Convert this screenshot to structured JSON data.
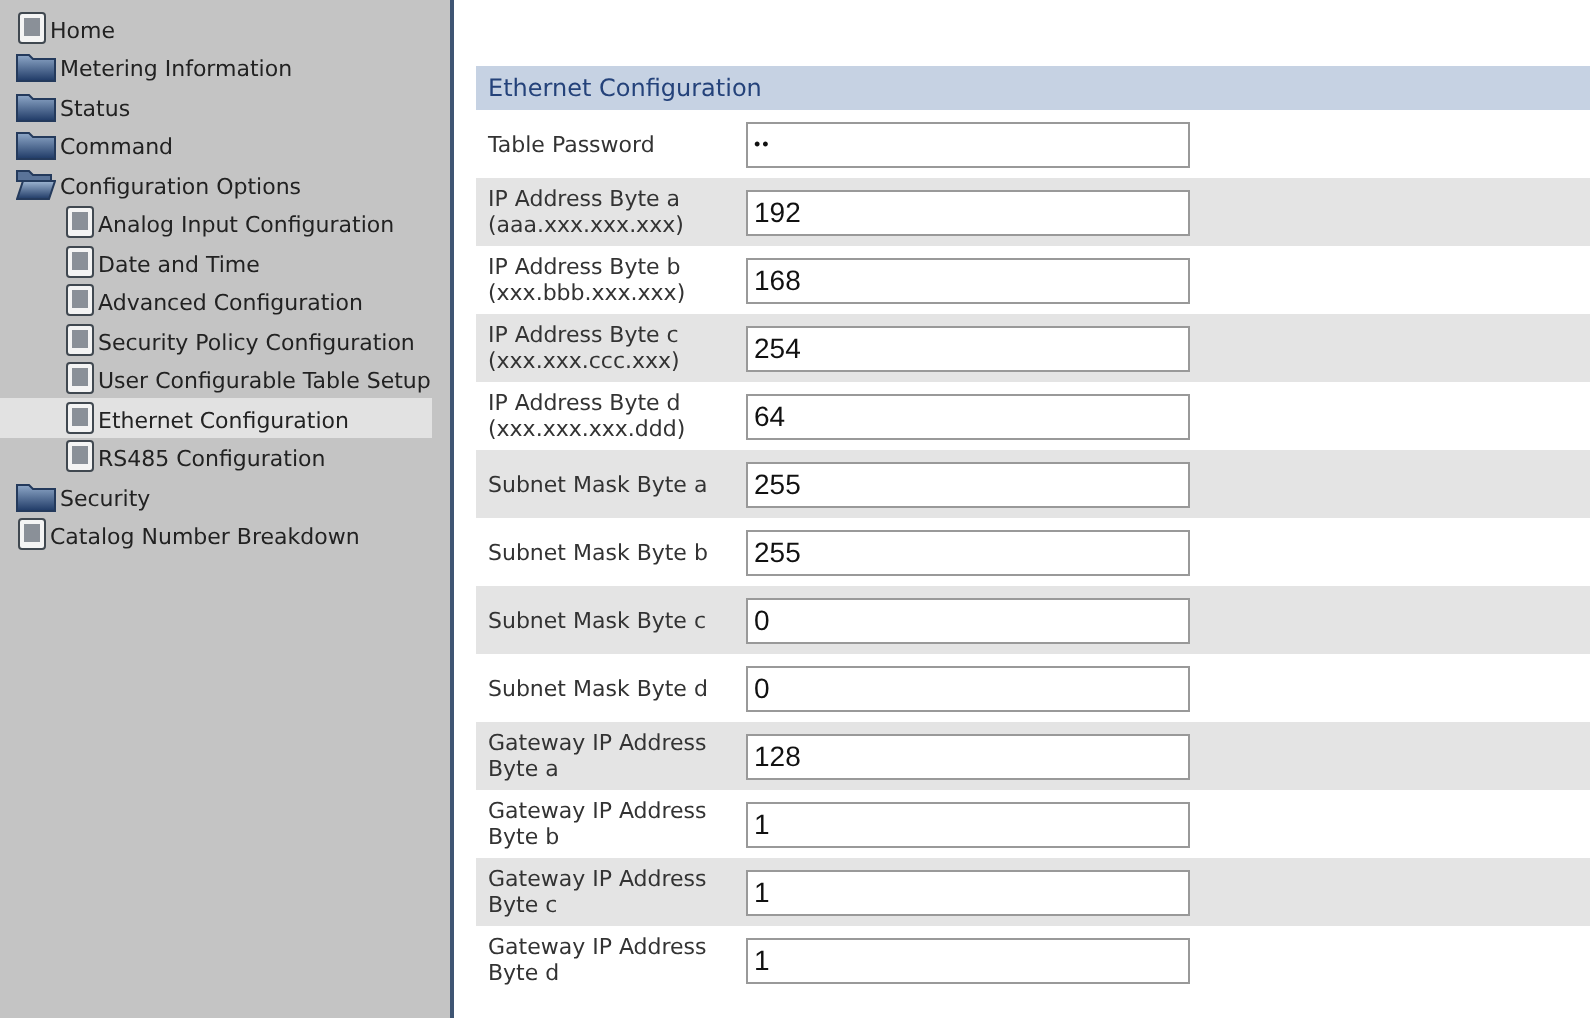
{
  "sidebar": {
    "items": [
      {
        "label": "Home",
        "kind": "page",
        "selected": false
      },
      {
        "label": "Metering Information",
        "kind": "folder",
        "expanded": false,
        "selected": false
      },
      {
        "label": "Status",
        "kind": "folder",
        "expanded": false,
        "selected": false
      },
      {
        "label": "Command",
        "kind": "folder",
        "expanded": false,
        "selected": false
      },
      {
        "label": "Configuration Options",
        "kind": "folder",
        "expanded": true,
        "selected": false,
        "children": [
          {
            "label": "Analog Input Configuration",
            "kind": "page",
            "selected": false
          },
          {
            "label": "Date and Time",
            "kind": "page",
            "selected": false
          },
          {
            "label": "Advanced Configuration",
            "kind": "page",
            "selected": false
          },
          {
            "label": "Security Policy Configuration",
            "kind": "page",
            "selected": false
          },
          {
            "label": "User Configurable Table Setup",
            "kind": "page",
            "selected": false
          },
          {
            "label": "Ethernet Configuration",
            "kind": "page",
            "selected": true
          },
          {
            "label": "RS485 Configuration",
            "kind": "page",
            "selected": false
          }
        ]
      },
      {
        "label": "Security",
        "kind": "folder",
        "expanded": false,
        "selected": false
      },
      {
        "label": "Catalog Number Breakdown",
        "kind": "page",
        "selected": false
      }
    ]
  },
  "form": {
    "title": "Ethernet Configuration",
    "rows": [
      {
        "label": "Table Password",
        "value": "••"
      },
      {
        "label": "IP Address Byte a\n(aaa.xxx.xxx.xxx)",
        "value": "192"
      },
      {
        "label": "IP Address Byte b\n(xxx.bbb.xxx.xxx)",
        "value": "168"
      },
      {
        "label": "IP Address Byte c\n(xxx.xxx.ccc.xxx)",
        "value": "254"
      },
      {
        "label": "IP Address Byte d\n(xxx.xxx.xxx.ddd)",
        "value": "64"
      },
      {
        "label": "Subnet Mask Byte a",
        "value": "255"
      },
      {
        "label": "Subnet Mask Byte b",
        "value": "255"
      },
      {
        "label": "Subnet Mask Byte c",
        "value": "0"
      },
      {
        "label": "Subnet Mask Byte d",
        "value": "0"
      },
      {
        "label": "Gateway IP Address\nByte a",
        "value": "128"
      },
      {
        "label": "Gateway IP Address\nByte b",
        "value": "1"
      },
      {
        "label": "Gateway IP Address\nByte c",
        "value": "1"
      },
      {
        "label": "Gateway IP Address\nByte d",
        "value": "1"
      }
    ]
  }
}
